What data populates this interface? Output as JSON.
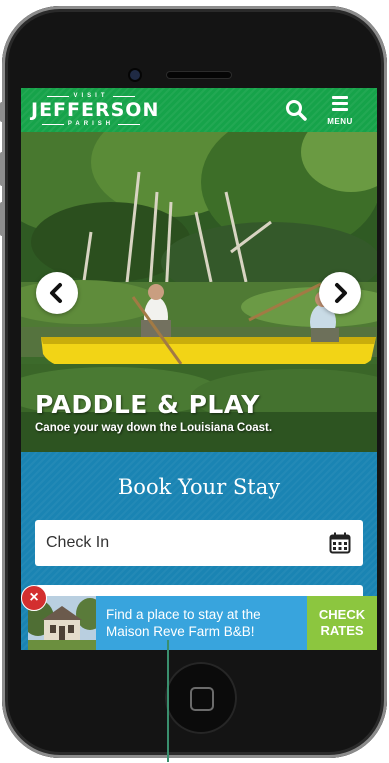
{
  "header": {
    "logo_top": "VISIT",
    "logo_main": "JEFFERSON",
    "logo_bottom": "PARISH",
    "search_icon": "search-icon",
    "menu_icon": "hamburger-icon",
    "menu_label": "MENU",
    "color": "#16a34a"
  },
  "hero": {
    "title": "PADDLE & PLAY",
    "subtitle": "Canoe your way down the Louisiana Coast.",
    "prev_icon": "chevron-left-icon",
    "next_icon": "chevron-right-icon"
  },
  "booking": {
    "title": "Book Your Stay",
    "checkin_placeholder": "Check In",
    "calendar_icon": "calendar-icon",
    "color": "#1a84b3"
  },
  "promo": {
    "text": "Find a place to stay at the Maison Reve Farm B&B!",
    "cta": "CHECK RATES",
    "close_icon": "close-icon",
    "close_glyph": "×",
    "text_color": "#38a4dd",
    "cta_color": "#8cc63f"
  }
}
